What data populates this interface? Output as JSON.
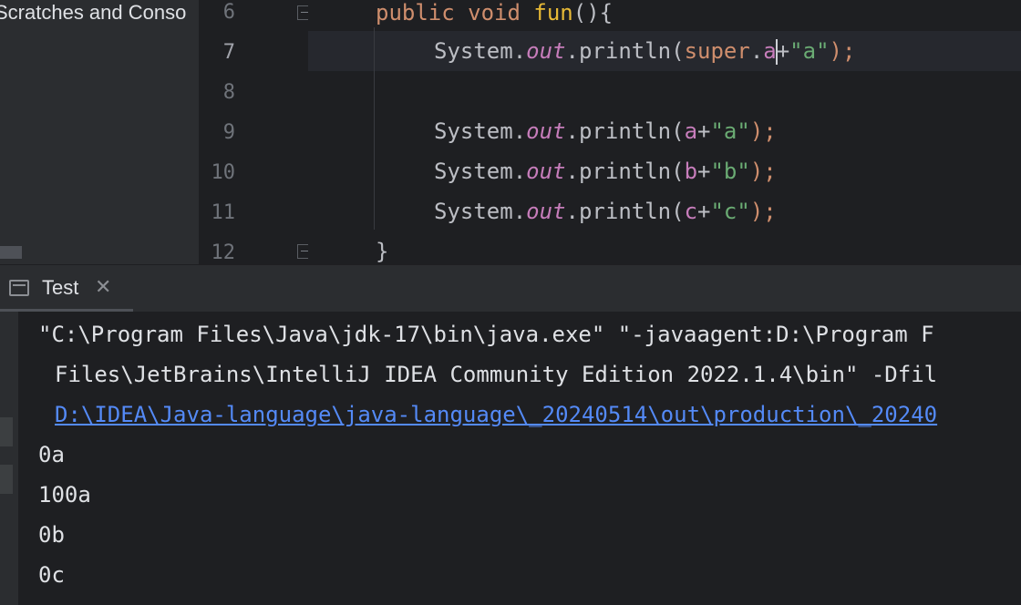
{
  "project_panel": {
    "item_label": "Scratches and Conso"
  },
  "gutter": {
    "line_numbers": [
      "6",
      "7",
      "8",
      "9",
      "10",
      "11",
      "12"
    ]
  },
  "editor": {
    "line6": {
      "kw1": "public",
      "kw2": "void",
      "method": "fun",
      "rest": "(){"
    },
    "line7": {
      "cls": "System.",
      "field": "out",
      "call": ".println(",
      "kw": "super",
      "dot": ".",
      "var_a": "a",
      "plus": "+",
      "str": "\"a\"",
      "end": ");"
    },
    "line9": {
      "cls": "System.",
      "field": "out",
      "call": ".println(",
      "var": "a",
      "plus": "+",
      "str": "\"a\"",
      "end": ");"
    },
    "line10": {
      "cls": "System.",
      "field": "out",
      "call": ".println(",
      "var": "b",
      "plus": "+",
      "str": "\"b\"",
      "end": ");"
    },
    "line11": {
      "cls": "System.",
      "field": "out",
      "call": ".println(",
      "var": "c",
      "plus": "+",
      "str": "\"c\"",
      "end": ");"
    },
    "line12": {
      "brace": "}"
    }
  },
  "run_panel": {
    "tab_label": "Test",
    "tab_close": "✕",
    "console_lines": [
      "\"C:\\Program Files\\Java\\jdk-17\\bin\\java.exe\" \"-javaagent:D:\\Program F",
      "Files\\JetBrains\\IntelliJ IDEA Community Edition 2022.1.4\\bin\" -Dfil",
      "D:\\IDEA\\Java-language\\java-language\\_20240514\\out\\production\\_20240",
      "0a",
      "100a",
      "0b",
      "0c"
    ]
  },
  "colors": {
    "background": "#1e1f22",
    "keyword": "#cf8e6d",
    "string": "#6aab73",
    "field": "#c77dbb",
    "link": "#548af7"
  },
  "icons": [
    "fold-marker-icon",
    "run-console-icon",
    "close-icon"
  ]
}
